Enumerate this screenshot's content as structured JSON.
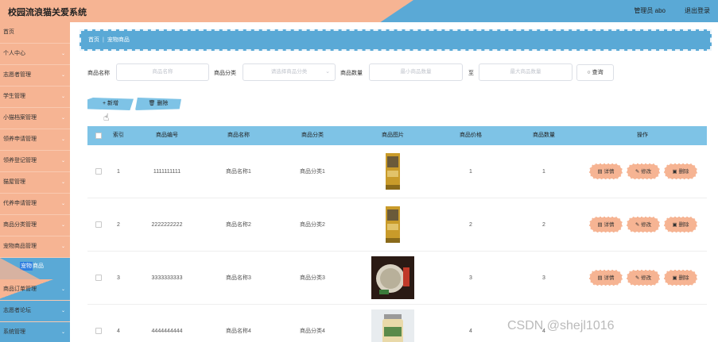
{
  "header": {
    "title": "校园流浪猫关爱系统",
    "user": "管理员 abo",
    "logout": "退出登录"
  },
  "sidebar": {
    "items": [
      {
        "label": "首页"
      },
      {
        "label": "个人中心"
      },
      {
        "label": "志愿者管理"
      },
      {
        "label": "学生管理"
      },
      {
        "label": "小猫档案管理"
      },
      {
        "label": "领养申请管理"
      },
      {
        "label": "领养登记管理"
      },
      {
        "label": "猫屋管理"
      },
      {
        "label": "代养申请管理"
      },
      {
        "label": "商品分类管理"
      },
      {
        "label": "宠物商品管理"
      }
    ],
    "active_sub": {
      "hl": "宠物",
      "rest": "商品"
    },
    "bottom_items": [
      {
        "label": "商品订单管理"
      },
      {
        "label": "志愿者论坛"
      },
      {
        "label": "系统管理"
      }
    ]
  },
  "breadcrumb": {
    "home": "首页",
    "sep": "|",
    "current": "宠物商品"
  },
  "search": {
    "name_label": "商品名称",
    "name_placeholder": "商品名称",
    "category_label": "商品分类",
    "category_placeholder": "请选择商品分类",
    "qty_label": "商品数量",
    "qty_min_placeholder": "最小商品数量",
    "to_label": "至",
    "qty_max_placeholder": "最大商品数量",
    "query_label": "查询"
  },
  "toolbar": {
    "add_label": "新增",
    "delete_label": "删除"
  },
  "table": {
    "headers": [
      "索引",
      "商品编号",
      "商品名称",
      "商品分类",
      "商品图片",
      "商品价格",
      "商品数量",
      "操作"
    ],
    "rows": [
      {
        "index": "1",
        "code": "1111111111",
        "name": "商品名称1",
        "category": "商品分类1",
        "price": "1",
        "qty": "1"
      },
      {
        "index": "2",
        "code": "2222222222",
        "name": "商品名称2",
        "category": "商品分类2",
        "price": "2",
        "qty": "2"
      },
      {
        "index": "3",
        "code": "3333333333",
        "name": "商品名称3",
        "category": "商品分类3",
        "price": "3",
        "qty": "3"
      },
      {
        "index": "4",
        "code": "4444444444",
        "name": "商品名称4",
        "category": "商品分类4",
        "price": "4",
        "qty": "4"
      }
    ],
    "actions": {
      "detail": "详情",
      "edit": "修改",
      "delete": "删除"
    }
  },
  "watermark": "CSDN @shejl1016",
  "colors": {
    "peach": "#f6b493",
    "blue": "#5aa9d6",
    "light_blue": "#7ec3e6",
    "highlight": "#2f7fe0"
  },
  "icons": {
    "detail": "detail-icon",
    "edit": "edit-icon",
    "delete": "trash-icon",
    "add": "plus-icon",
    "search": "search-icon",
    "chevron": "chevron-down-icon"
  }
}
